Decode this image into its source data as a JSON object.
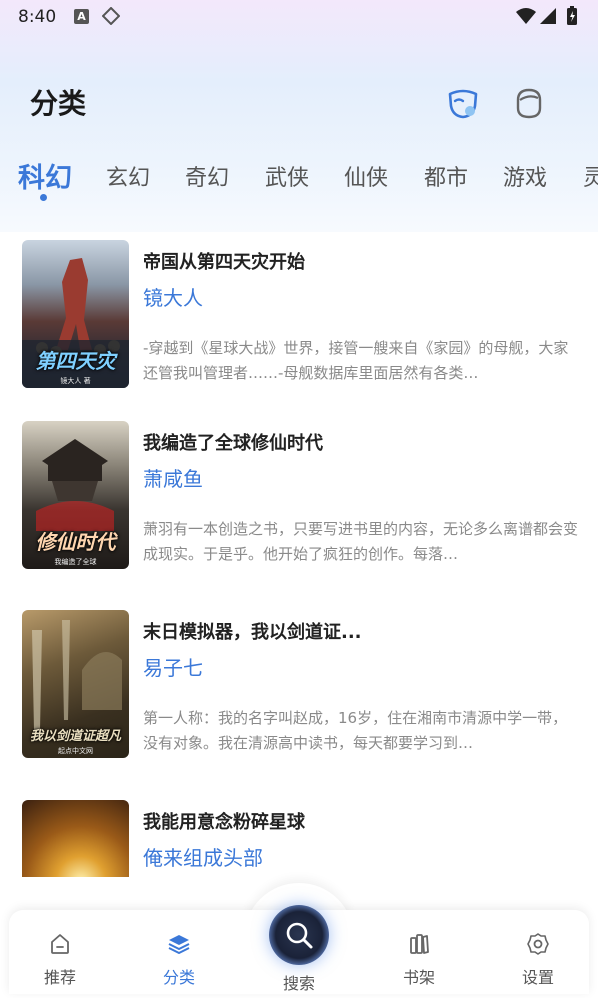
{
  "status_bar": {
    "time": "8:40",
    "a_badge": "A"
  },
  "header": {
    "title": "分类"
  },
  "tabs": [
    {
      "label": "科幻",
      "active": true
    },
    {
      "label": "玄幻",
      "active": false
    },
    {
      "label": "奇幻",
      "active": false
    },
    {
      "label": "武侠",
      "active": false
    },
    {
      "label": "仙侠",
      "active": false
    },
    {
      "label": "都市",
      "active": false
    },
    {
      "label": "游戏",
      "active": false
    },
    {
      "label": "灵",
      "active": false
    }
  ],
  "books": [
    {
      "title": "帝国从第四天灾开始",
      "author": "镜大人",
      "description": "-穿越到《星球大战》世界，接管一艘来自《家园》的母舰，大家还管我叫管理者……-母舰数据库里面居然有各类…",
      "cover_text": "第四天灾",
      "cover_sub": "镜大人 著"
    },
    {
      "title": "我编造了全球修仙时代",
      "author": "萧咸鱼",
      "description": "萧羽有一本创造之书，只要写进书里的内容，无论多么离谱都会变成现实。于是乎。他开始了疯狂的创作。每落…",
      "cover_text": "修仙时代",
      "cover_sub": "我编造了全球"
    },
    {
      "title": "末日模拟器，我以剑道证...",
      "author": "易子七",
      "description": "第一人称：我的名字叫赵成，16岁，住在湘南市清源中学一带，没有对象。我在清源高中读书，每天都要学习到…",
      "cover_text": "我以剑道证超凡",
      "cover_sub": "起点中文网"
    },
    {
      "title": "我能用意念粉碎星球",
      "author": "俺来组成头部",
      "description": "",
      "cover_text": "",
      "cover_sub": ""
    }
  ],
  "bottom_nav": {
    "items": [
      {
        "label": "推荐",
        "icon": "home-icon"
      },
      {
        "label": "分类",
        "icon": "layers-icon",
        "active": true
      },
      {
        "label": "书架",
        "icon": "bookshelf-icon"
      },
      {
        "label": "设置",
        "icon": "gear-icon"
      }
    ],
    "search_label": "搜索"
  },
  "colors": {
    "accent": "#3b78d8",
    "text": "#222222",
    "muted": "#8a8a8a"
  }
}
